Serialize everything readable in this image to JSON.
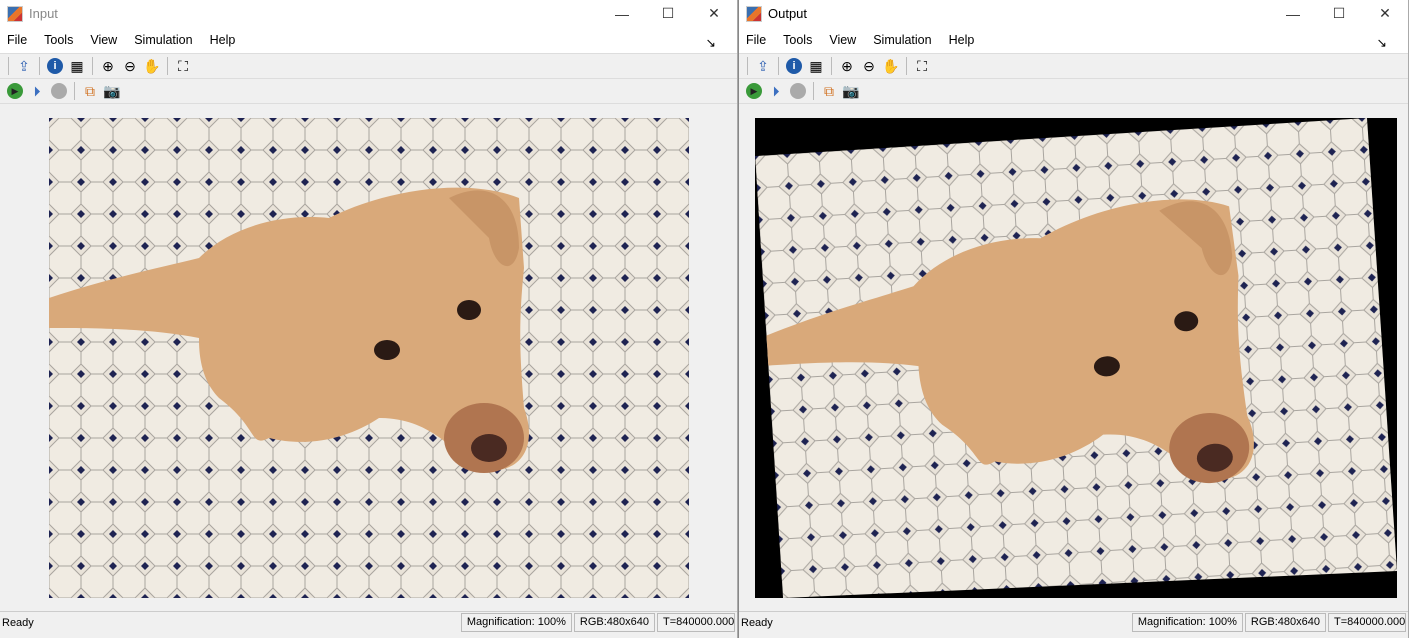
{
  "windows": [
    {
      "title": "Input",
      "menu": [
        "File",
        "Tools",
        "View",
        "Simulation",
        "Help"
      ],
      "status": {
        "ready": "Ready",
        "magnification": "Magnification: 100%",
        "rgb": "RGB:480x640",
        "time": "T=840000.000"
      }
    },
    {
      "title": "Output",
      "menu": [
        "File",
        "Tools",
        "View",
        "Simulation",
        "Help"
      ],
      "status": {
        "ready": "Ready",
        "magnification": "Magnification: 100%",
        "rgb": "RGB:480x640",
        "time": "T=840000.000"
      }
    }
  ],
  "icons": {
    "minimize": "—",
    "maximize": "☐",
    "close": "✕",
    "dock": "↘"
  }
}
